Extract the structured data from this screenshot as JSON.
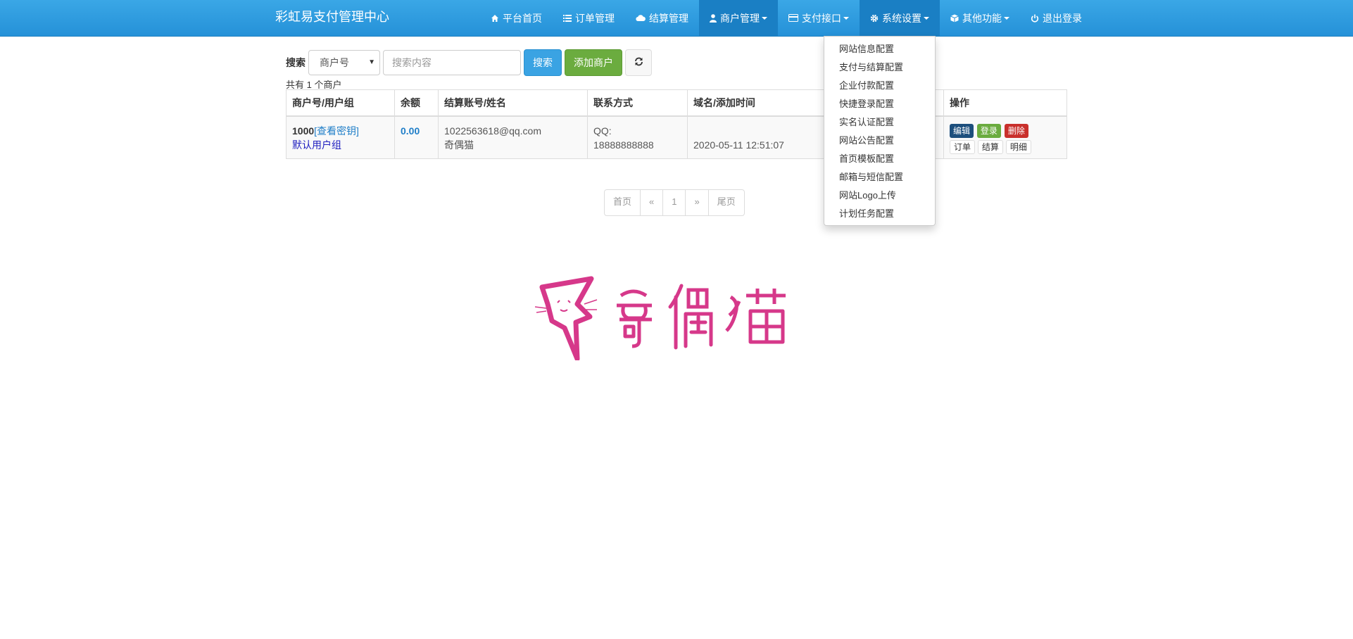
{
  "navbar": {
    "brand": "彩虹易支付管理中心",
    "items": [
      {
        "label": "平台首页",
        "icon": "home-icon"
      },
      {
        "label": "订单管理",
        "icon": "list-icon"
      },
      {
        "label": "结算管理",
        "icon": "cloud-icon"
      },
      {
        "label": "商户管理",
        "icon": "user-icon",
        "dropdown": true,
        "active": true
      },
      {
        "label": "支付接口",
        "icon": "credit-card-icon",
        "dropdown": true
      },
      {
        "label": "系统设置",
        "icon": "gear-icon",
        "dropdown": true,
        "active": true
      },
      {
        "label": "其他功能",
        "icon": "cube-icon",
        "dropdown": true
      },
      {
        "label": "退出登录",
        "icon": "power-icon"
      }
    ]
  },
  "search": {
    "label": "搜索",
    "field_select": "商户号",
    "placeholder": "搜索内容",
    "search_button": "搜索",
    "add_button": "添加商户"
  },
  "count_text": "共有 1 个商户",
  "table": {
    "headers": [
      "商户号/用户组",
      "余额",
      "结算账号/姓名",
      "联系方式",
      "域名/添加时间",
      "",
      "操作"
    ],
    "rows": [
      {
        "merchant_id": "1000",
        "key_link": "查看密钥",
        "group": "默认用户组",
        "balance": "0.00",
        "account": "1022563618@qq.com",
        "name": "奇偶猫",
        "contact_label": "QQ:",
        "contact_value": "18888888888",
        "add_time": "2020-05-11 12:51:07",
        "ops": {
          "edit": "编辑",
          "login": "登录",
          "delete": "删除",
          "orders": "订单",
          "settle": "结算",
          "detail": "明细"
        }
      }
    ]
  },
  "pagination": [
    "首页",
    "«",
    "1",
    "»",
    "尾页"
  ],
  "dropdown": {
    "items": [
      "网站信息配置",
      "支付与结算配置",
      "企业付款配置",
      "快捷登录配置",
      "实名认证配置",
      "网站公告配置",
      "首页模板配置",
      "邮箱与短信配置",
      "网站Logo上传",
      "计划任务配置"
    ]
  },
  "logo": {
    "text": "奇偶猫",
    "color": "#d6388a"
  },
  "colors": {
    "navbar": "#2a9ae0",
    "primary": "#3aa3e3",
    "success": "#6bac3f",
    "danger": "#c9302c"
  }
}
